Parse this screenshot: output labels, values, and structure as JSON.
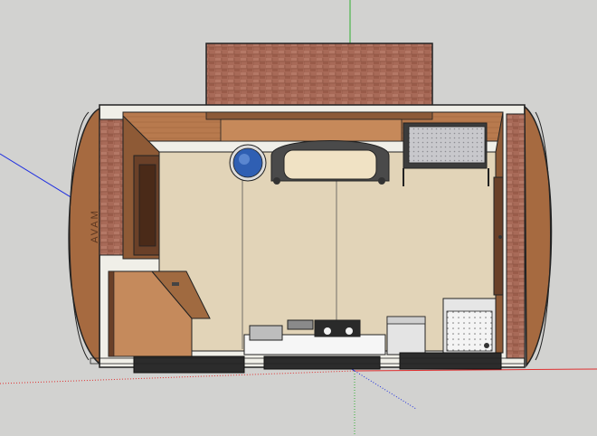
{
  "app": {
    "canvas_background": "#d2d2d0"
  },
  "model": {
    "wall_sign_text": "AVAM",
    "palette": {
      "brick": "#a86a58",
      "brick_dark": "#8c5444",
      "wood": "#b87a4e",
      "wood_dark": "#7a4a2c",
      "floor": "#e2d4b8",
      "outline": "#222222",
      "water_blue": "#2f5fb3",
      "white": "#f2f2f2"
    },
    "objects": [
      "brick-chimney",
      "left-end-cap",
      "right-end-cap",
      "top-wall",
      "water-jar",
      "sofa",
      "bench-seat",
      "cabinet",
      "sink",
      "stove",
      "trash-bin",
      "shower-stall",
      "wall-window",
      "door"
    ]
  },
  "axes": {
    "x_color": "#e03030",
    "y_color": "#30b030",
    "z_color": "#2030e0"
  }
}
